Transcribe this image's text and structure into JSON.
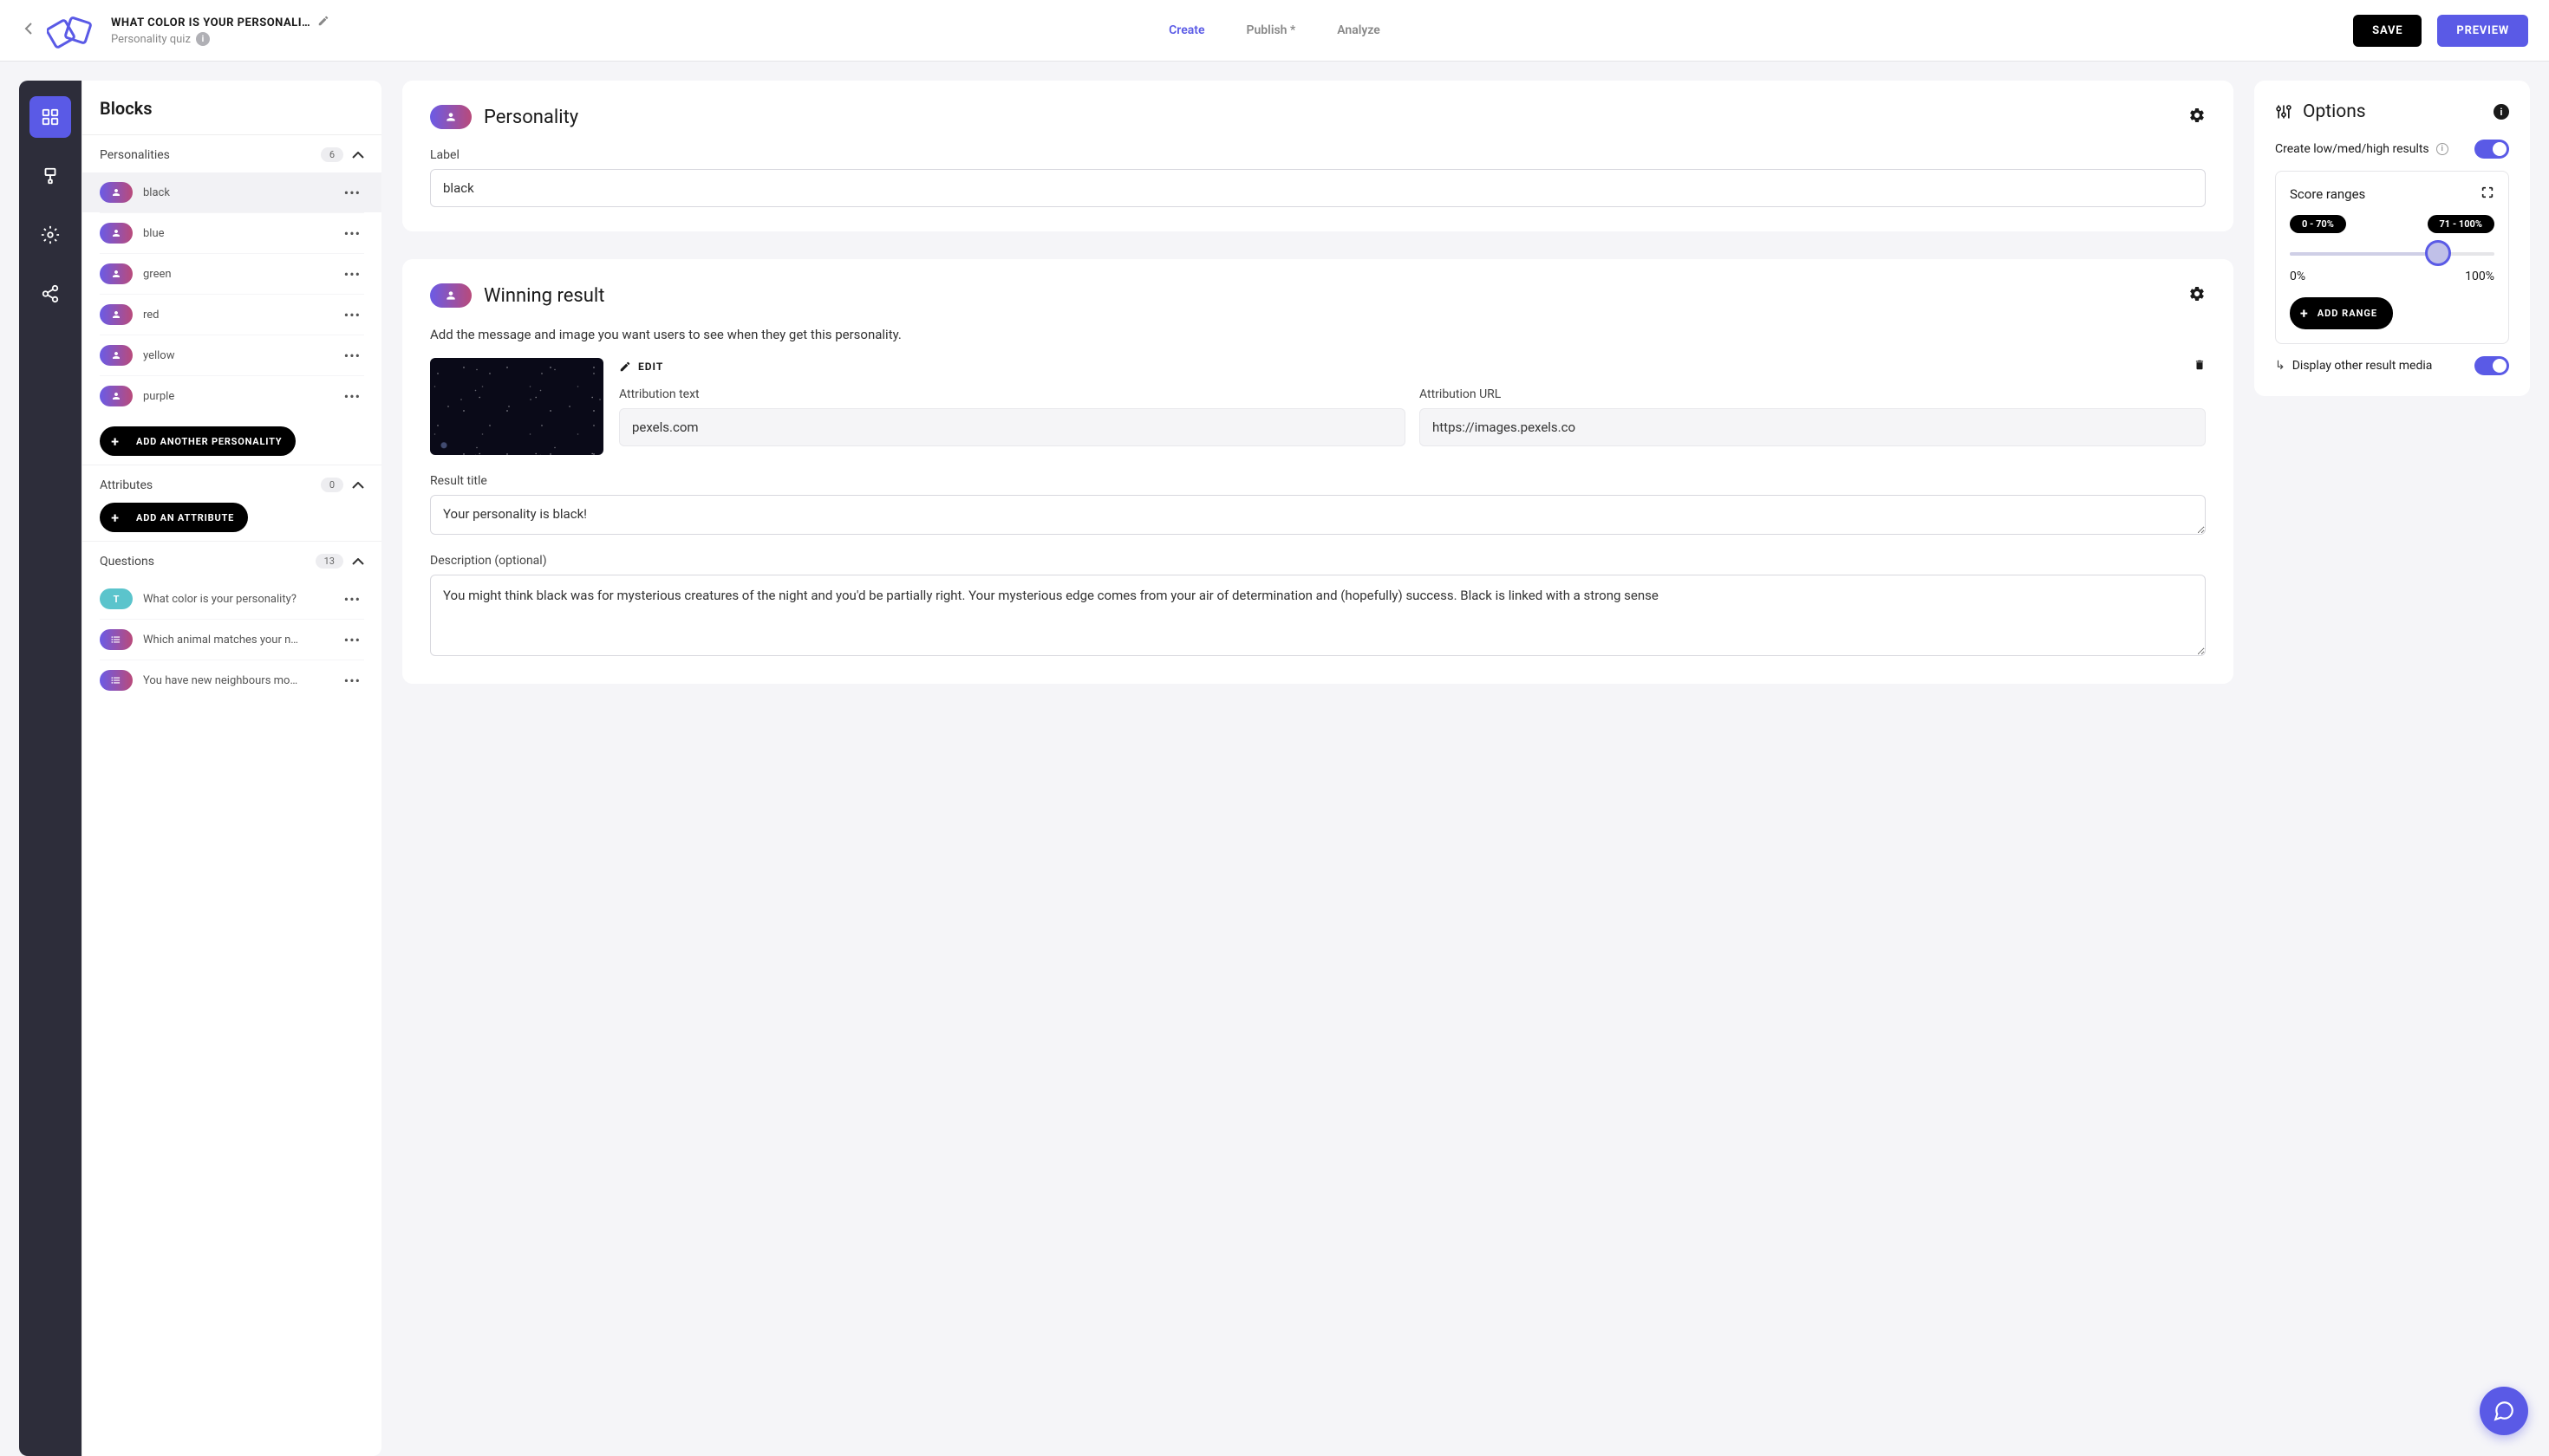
{
  "header": {
    "title": "WHAT COLOR IS YOUR PERSONALI…",
    "subtitle": "Personality quiz",
    "tabs": {
      "create": "Create",
      "publish": "Publish *",
      "analyze": "Analyze"
    },
    "save": "SAVE",
    "preview": "PREVIEW"
  },
  "blocks": {
    "title": "Blocks",
    "sections": {
      "personalities": {
        "title": "Personalities",
        "count": "6"
      },
      "attributes": {
        "title": "Attributes",
        "count": "0"
      },
      "questions": {
        "title": "Questions",
        "count": "13"
      }
    },
    "personalities": [
      {
        "label": "black"
      },
      {
        "label": "blue"
      },
      {
        "label": "green"
      },
      {
        "label": "red"
      },
      {
        "label": "yellow"
      },
      {
        "label": "purple"
      }
    ],
    "questions": [
      {
        "label": "What color is your personality?",
        "type": "t"
      },
      {
        "label": "Which animal matches your n…",
        "type": "q"
      },
      {
        "label": "You have new neighbours mo…",
        "type": "q"
      }
    ],
    "addPersonality": "ADD ANOTHER PERSONALITY",
    "addAttribute": "ADD AN ATTRIBUTE"
  },
  "personalityCard": {
    "title": "Personality",
    "labelField": "Label",
    "labelValue": "black"
  },
  "winningResult": {
    "title": "Winning result",
    "helper": "Add the message and image you want users to see when they get this personality.",
    "edit": "EDIT",
    "attrTextLabel": "Attribution text",
    "attrTextValue": "pexels.com",
    "attrUrlLabel": "Attribution URL",
    "attrUrlValue": "https://images.pexels.co",
    "resultTitleLabel": "Result title",
    "resultTitleValue": "Your personality is black!",
    "descLabel": "Description (optional)",
    "descValue": "You might think black was for mysterious creatures of the night and you'd be partially right. Your mysterious edge comes from your air of determination and (hopefully) success. Black is linked with a strong sense"
  },
  "options": {
    "title": "Options",
    "createResults": "Create low/med/high results",
    "scoreRanges": "Score ranges",
    "range1": "0 - 70%",
    "range2": "71 - 100%",
    "min": "0%",
    "max": "100%",
    "addRange": "ADD RANGE",
    "displayOther": "Display other result media"
  }
}
